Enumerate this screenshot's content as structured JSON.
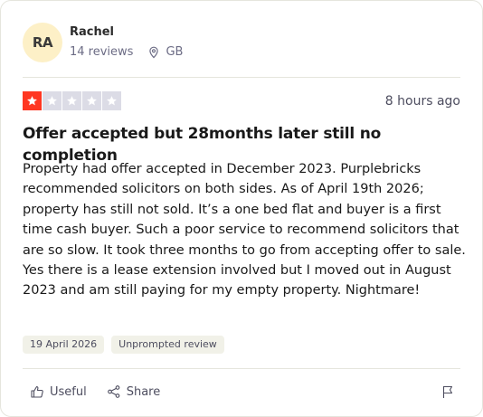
{
  "reviewer": {
    "initials": "RA",
    "name": "Rachel",
    "reviews_count": "14 reviews",
    "location": "GB",
    "avatar_color": "#fdf0c7"
  },
  "review": {
    "rating": 1,
    "max_rating": 5,
    "time_ago": "8 hours ago",
    "title": "Offer accepted but 28months later still no completion",
    "body": "Property had offer accepted in December 2023.  Purplebricks recommended solicitors on both sides.  As of April 19th 2026; property has still not sold.  It’s a one bed flat and buyer is a first time cash buyer. Such a poor service to recommend solicitors that are so slow.  It took three months to go from accepting offer to sale.  Yes there is a lease extension involved but I moved out in August 2023 and am still paying for my empty property. Nightmare!",
    "date_tag": "19 April 2026",
    "type_tag": "Unprompted review",
    "star_color": "#ff3722",
    "empty_star_color": "#dcdce6"
  },
  "actions": {
    "useful_label": "Useful",
    "share_label": "Share",
    "useful_icon": "thumbs-up-icon",
    "share_icon": "share-icon",
    "flag_icon": "flag-icon"
  }
}
